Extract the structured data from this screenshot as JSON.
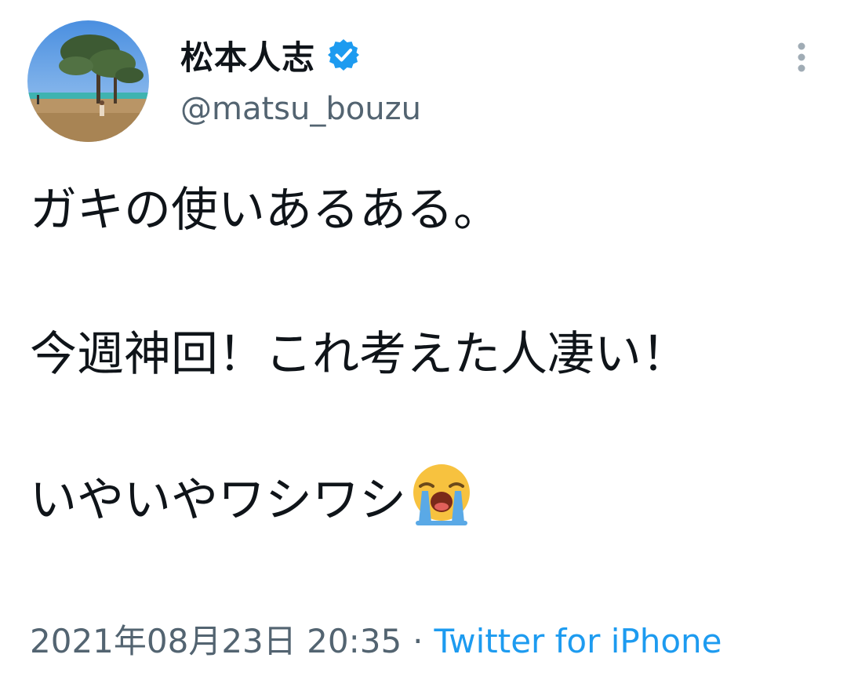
{
  "author": {
    "display_name": "松本人志",
    "handle": "@matsu_bouzu",
    "verified": true,
    "avatar_icon": "profile-photo-beach-trees"
  },
  "tweet": {
    "line1": "ガキの使いあるある。",
    "line2": "今週神回！これ考えた人凄い！",
    "line3": "いやいやワシワシ",
    "emoji": "loudly-crying-face-icon"
  },
  "meta": {
    "timestamp": "2021年08月23日 20:35",
    "separator": "·",
    "source": "Twitter for iPhone"
  },
  "colors": {
    "verified_badge": "#1d9bf0",
    "secondary_text": "#536471",
    "link": "#1d9bf0"
  }
}
